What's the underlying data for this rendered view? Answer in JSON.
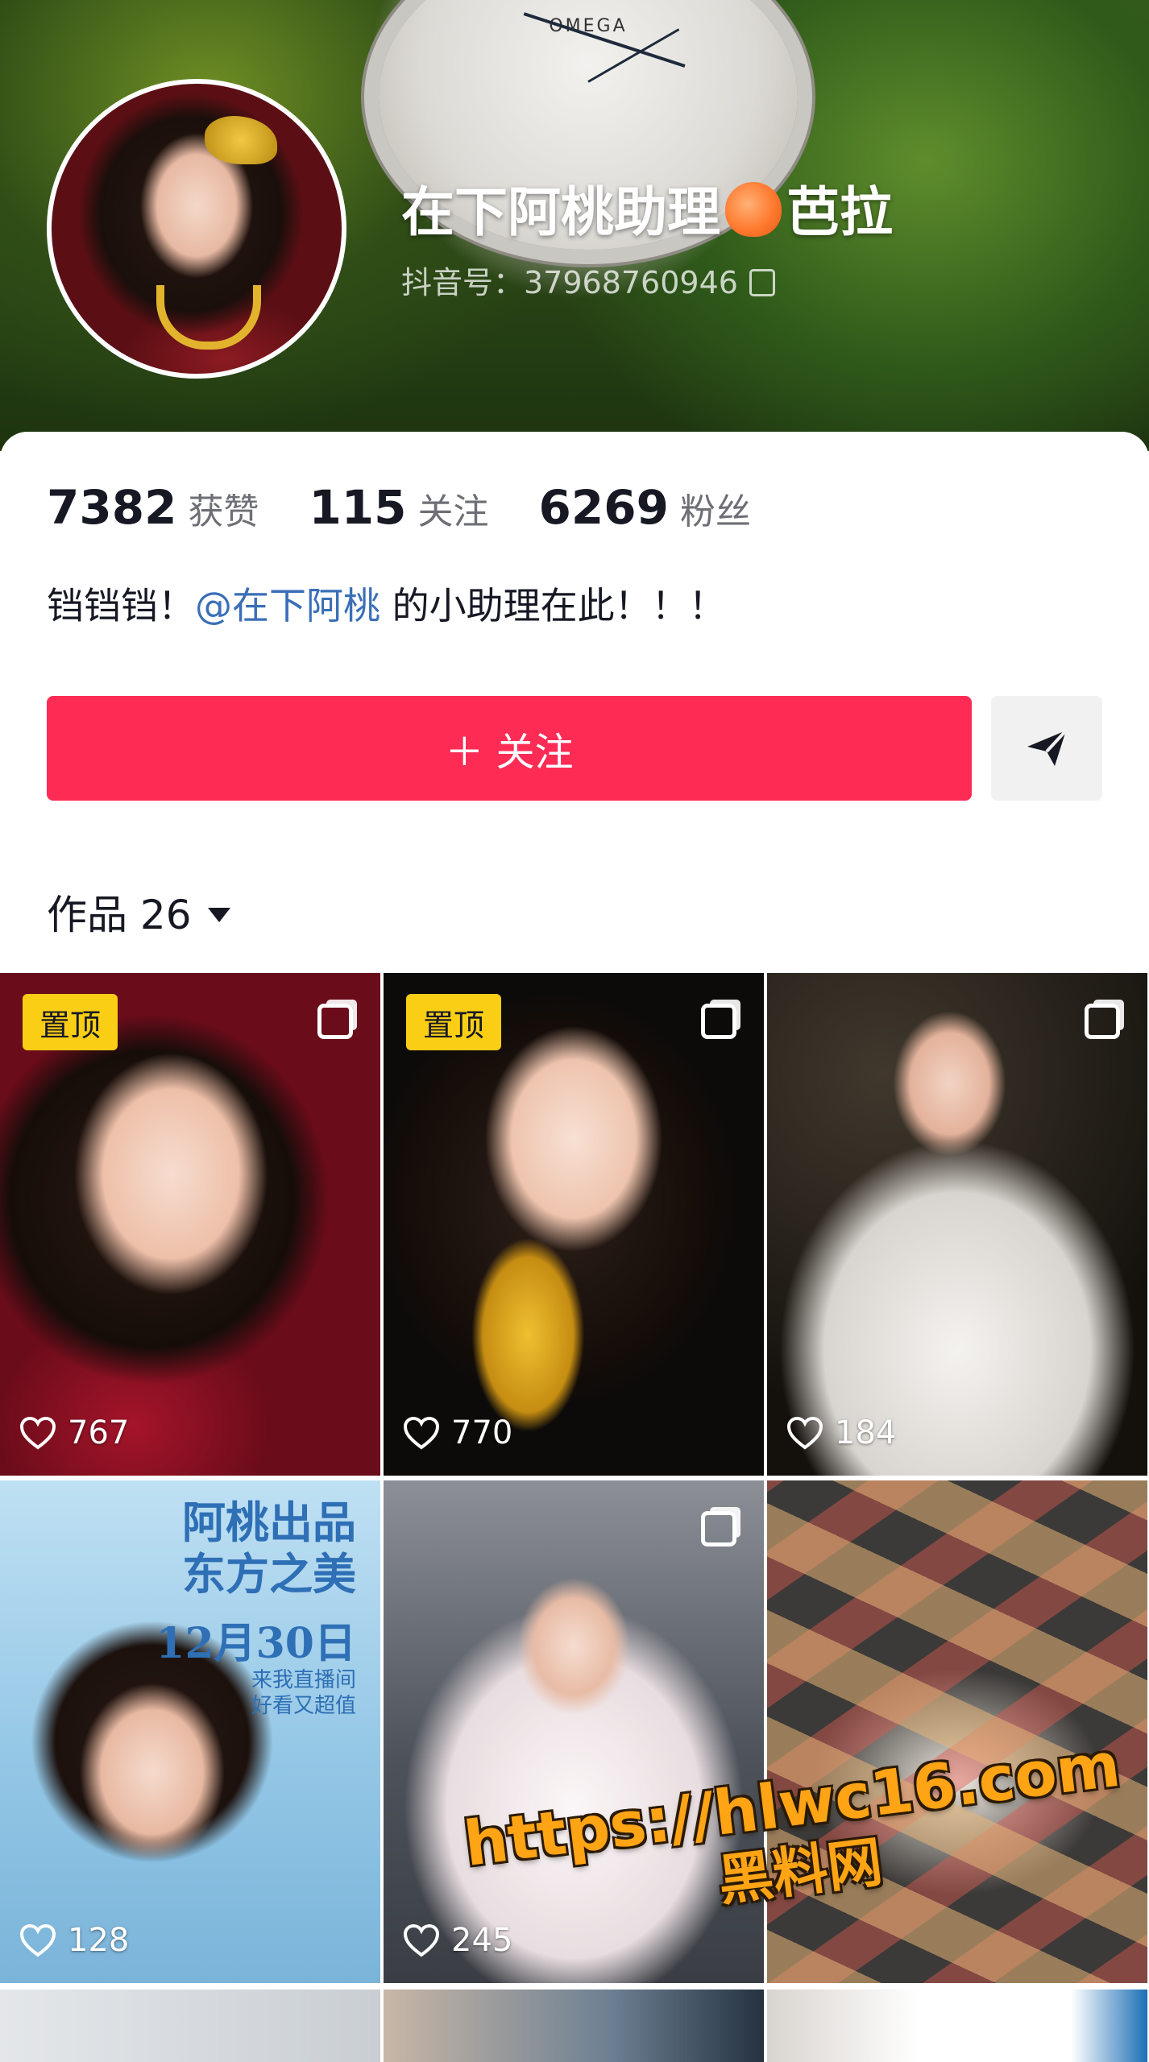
{
  "profile": {
    "nickname": "在下阿桃助理",
    "nickname_suffix": "芭拉",
    "douyin_id": "抖音号：37968760946",
    "watch_brand": "OMEGA"
  },
  "stats": {
    "likes_count": "7382",
    "likes_label": "获赞",
    "following_count": "115",
    "following_label": "关注",
    "followers_count": "6269",
    "followers_label": "粉丝"
  },
  "bio": {
    "prefix": "铛铛铛！",
    "mention": "@在下阿桃",
    "suffix": " 的小助理在此！！！"
  },
  "actions": {
    "follow_label": "＋ 关注"
  },
  "works": {
    "label": "作品 26"
  },
  "posts": [
    {
      "pinned_label": "置顶",
      "likes": "767"
    },
    {
      "pinned_label": "置顶",
      "likes": "770"
    },
    {
      "likes": "184"
    },
    {
      "likes": "128",
      "poster_title_1": "阿桃出品",
      "poster_title_2": "东方之美",
      "poster_date": "12月30日",
      "poster_sub_1": "来我直播间",
      "poster_sub_2": "好看又超值"
    },
    {
      "likes": "245"
    },
    {
      "likes": ""
    }
  ],
  "watermark": {
    "line1": "https://hlwc16.com",
    "line2": "黑料网"
  },
  "colors": {
    "follow_button": "#fe2c55",
    "mention": "#3a6fb7",
    "pinned_badge": "#face15",
    "watermark": "#ffa415"
  }
}
